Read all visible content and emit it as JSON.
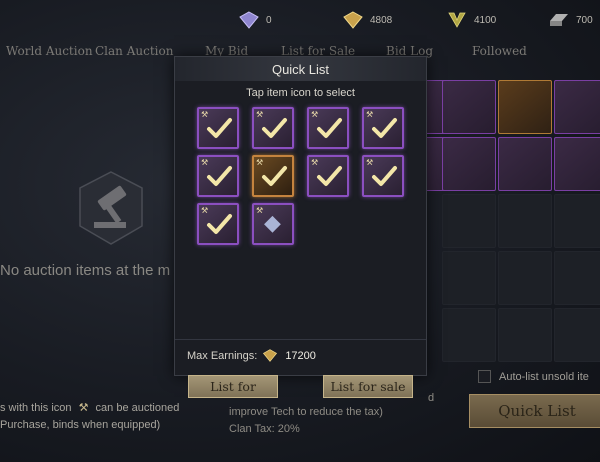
{
  "currencies": [
    {
      "name": "diamond",
      "value": "0",
      "color": "#9a8fd8"
    },
    {
      "name": "gold-gem",
      "value": "4808",
      "color": "#d8b25a"
    },
    {
      "name": "emblem",
      "value": "4100",
      "color": "#b9b04a"
    },
    {
      "name": "ingot",
      "value": "700",
      "color": "#9a9a9a"
    }
  ],
  "tabs": [
    "World Auction",
    "Clan Auction",
    "My Bid",
    "List for Sale",
    "Bid Log",
    "Followed"
  ],
  "empty_message": "No auction items at the m",
  "bottom_note": {
    "line1_prefix": "s with this icon",
    "line1_suffix": "can be auctioned",
    "line2": "Purchase, binds when equipped)"
  },
  "tax_note": {
    "fragment": "d",
    "line1": "improve Tech to reduce the tax)",
    "line2": "Clan Tax: 20%"
  },
  "autolist_label": "Auto-list unsold ite",
  "quick_list_button": "Quick List",
  "modal": {
    "title": "Quick List",
    "subtitle": "Tap item icon to select",
    "items": [
      {
        "rarity": "epic",
        "selected": true,
        "corner": "⚒"
      },
      {
        "rarity": "epic",
        "selected": true,
        "corner": "⚒"
      },
      {
        "rarity": "epic",
        "selected": true,
        "corner": "⚒"
      },
      {
        "rarity": "epic",
        "selected": true,
        "corner": "⚒"
      },
      {
        "rarity": "epic",
        "selected": true,
        "corner": "⚒"
      },
      {
        "rarity": "legendary",
        "selected": true,
        "corner": "⚒"
      },
      {
        "rarity": "epic",
        "selected": true,
        "corner": "⚒"
      },
      {
        "rarity": "epic",
        "selected": true,
        "corner": "⚒"
      },
      {
        "rarity": "epic",
        "selected": true,
        "corner": "⚒"
      },
      {
        "rarity": "epic",
        "selected": false,
        "corner": "⚒"
      }
    ],
    "earnings_label": "Max Earnings:",
    "earnings_value": "17200",
    "btn_left": "List for",
    "btn_right": "List for sale"
  }
}
